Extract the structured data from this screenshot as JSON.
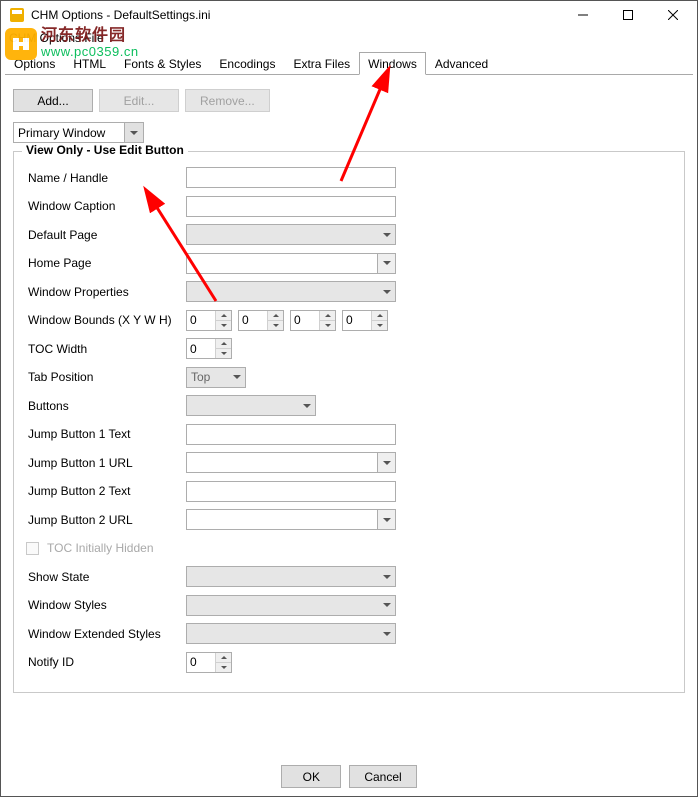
{
  "title": "CHM Options  - DefaultSettings.ini",
  "menu": "CHM Options File",
  "tabs": [
    "Options",
    "HTML",
    "Fonts & Styles",
    "Encodings",
    "Extra Files",
    "Windows",
    "Advanced"
  ],
  "active_tab": 5,
  "toolbar": {
    "add": "Add...",
    "edit": "Edit...",
    "remove": "Remove..."
  },
  "primary_dropdown": "Primary Window",
  "group_legend": "View Only - Use Edit Button",
  "rows": {
    "name": "Name / Handle",
    "caption": "Window Caption",
    "default_page": "Default Page",
    "home_page": "Home Page",
    "props": "Window Properties",
    "bounds": "Window Bounds (X Y W H)",
    "toc_width": "TOC Width",
    "tab_pos": "Tab Position",
    "tab_pos_value": "Top",
    "buttons": "Buttons",
    "jb1t": "Jump Button 1 Text",
    "jb1u": "Jump Button 1 URL",
    "jb2t": "Jump Button 2 Text",
    "jb2u": "Jump Button 2 URL",
    "toc_hidden": "TOC Initially Hidden",
    "show_state": "Show State",
    "styles": "Window Styles",
    "ex_styles": "Window Extended Styles",
    "notify": "Notify ID"
  },
  "bound_values": [
    "0",
    "0",
    "0",
    "0"
  ],
  "toc_width_value": "0",
  "notify_value": "0",
  "bottom": {
    "ok": "OK",
    "cancel": "Cancel"
  },
  "watermark": {
    "cn": "河东软件园",
    "url": "www.pc0359.cn"
  }
}
